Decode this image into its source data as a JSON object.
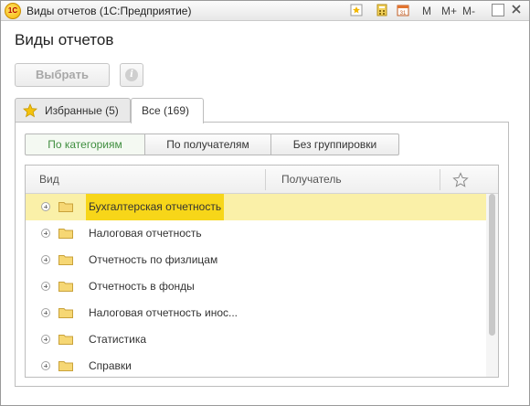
{
  "window": {
    "title": "Виды отчетов  (1С:Предприятие)",
    "logo_text": "1С",
    "toolbar_buttons": [
      "M",
      "M+",
      "M-"
    ]
  },
  "form": {
    "title": "Виды отчетов",
    "select_label": "Выбрать",
    "info_icon": "i"
  },
  "tabs": [
    {
      "label": "Избранные (5)",
      "icon": "star-icon"
    },
    {
      "label": "Все (169)"
    }
  ],
  "grouping": {
    "options": [
      "По категориям",
      "По получателям",
      "Без группировки"
    ],
    "selected": "По категориям",
    "active_color": "#3f8e3f"
  },
  "table": {
    "columns": [
      "Вид",
      "Получатель"
    ],
    "favorite_column_icon": "star-outline-icon",
    "rows": [
      {
        "name": "Бухгалтерская отчетность",
        "selected": true
      },
      {
        "name": "Налоговая отчетность"
      },
      {
        "name": "Отчетность по физлицам"
      },
      {
        "name": "Отчетность в фонды"
      },
      {
        "name": "Налоговая отчетность инос..."
      },
      {
        "name": "Статистика"
      },
      {
        "name": "Справки"
      }
    ],
    "selection_color": "#faf0a8",
    "highlight_color": "#f7d619"
  }
}
